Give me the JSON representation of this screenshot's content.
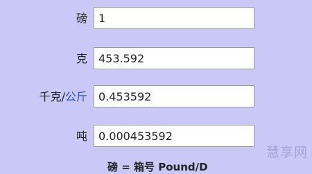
{
  "converter": {
    "rows": [
      {
        "label": "磅",
        "value": "1"
      },
      {
        "label": "克",
        "value": "453.592"
      },
      {
        "label_prefix": "千克/",
        "label_link": "公斤",
        "value": "0.453592"
      },
      {
        "label": "吨",
        "value": "0.000453592"
      }
    ],
    "footer_text": "磅 = 箱号 Pound/D"
  },
  "watermark": "慧享网"
}
